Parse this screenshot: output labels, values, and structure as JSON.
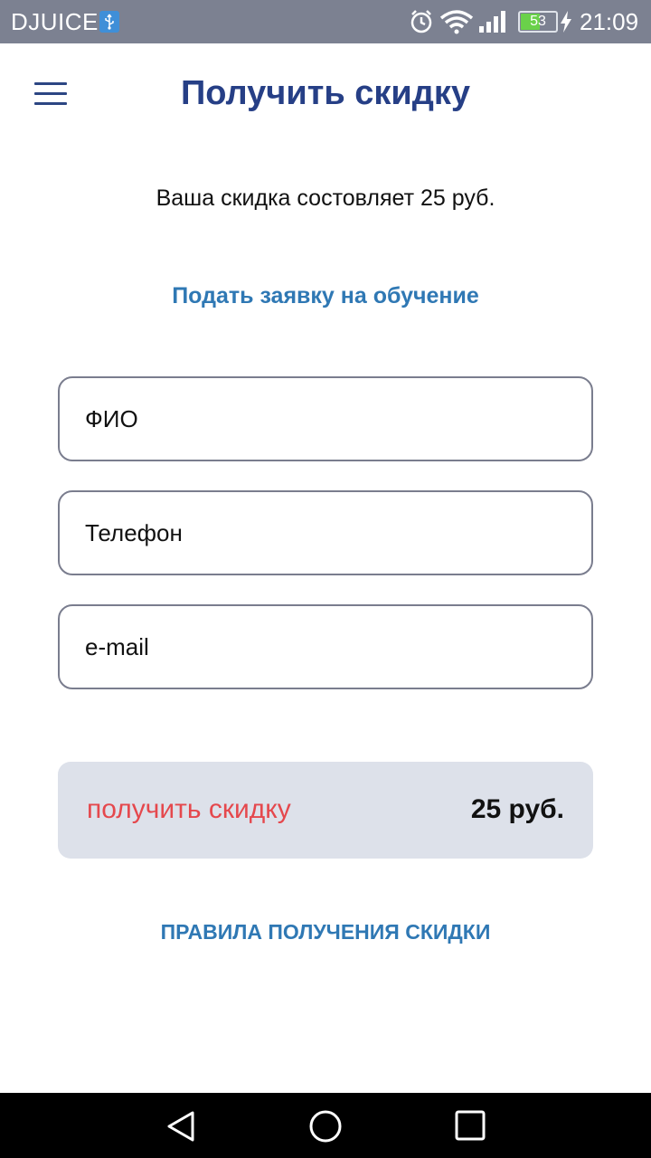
{
  "status_bar": {
    "carrier": "DJUICE",
    "battery_level": "53",
    "time": "21:09",
    "icons": [
      "usb-icon",
      "alarm-icon",
      "wifi-icon",
      "signal-icon",
      "battery-icon",
      "charging-icon"
    ]
  },
  "header": {
    "menu_icon": "hamburger-menu-icon",
    "title": "Получить скидку"
  },
  "main": {
    "discount_text": "Ваша скидка состовляет 25 руб.",
    "apply_link": "Подать заявку на обучение",
    "form": {
      "fio_placeholder": "ФИО",
      "phone_placeholder": "Телефон",
      "email_placeholder": "e-mail"
    },
    "button": {
      "label": "получить скидку",
      "amount": "25 руб."
    },
    "rules_link": "ПРАВИЛА ПОЛУЧЕНИЯ СКИДКИ"
  },
  "nav_bar": {
    "icons": [
      "back-icon",
      "home-icon",
      "recent-apps-icon"
    ]
  },
  "colors": {
    "title": "#263f86",
    "link": "#2f78b4",
    "button_bg": "#dde1ea",
    "button_label": "#e5484d",
    "status_bar_bg": "#7c8191"
  }
}
